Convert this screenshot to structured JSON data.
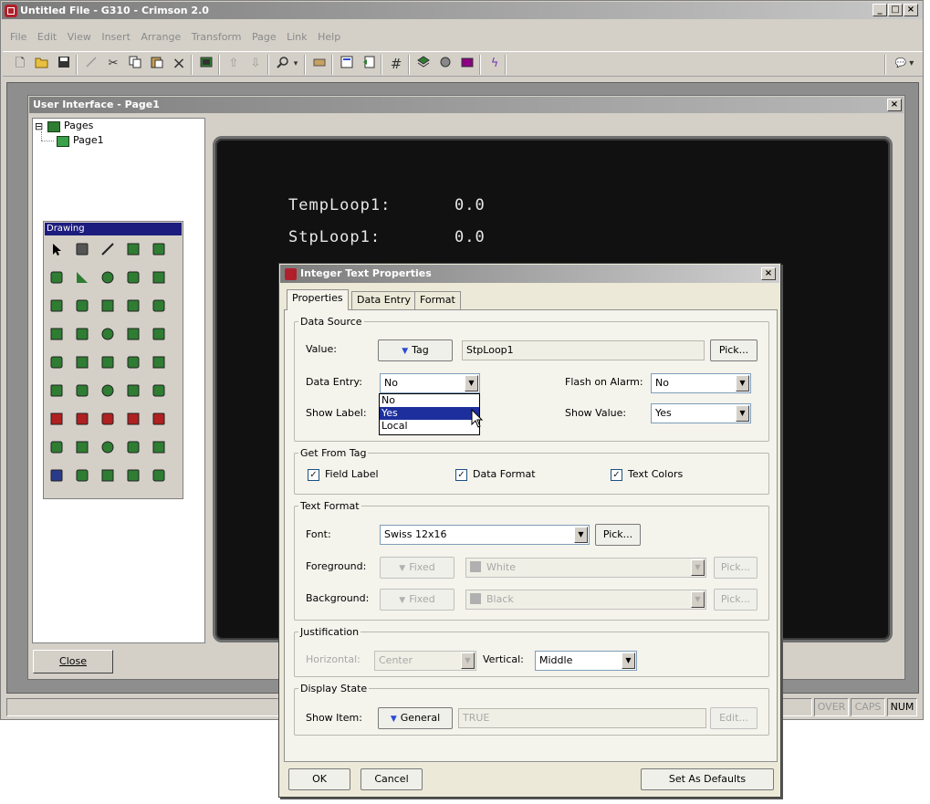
{
  "app": {
    "title": "Untitled File - G310 - Crimson 2.0",
    "min": "_",
    "max": "□",
    "close": "×",
    "menu": [
      "File",
      "Edit",
      "View",
      "Insert",
      "Arrange",
      "Transform",
      "Page",
      "Link",
      "Help"
    ],
    "toolbar_icons": [
      "new-icon",
      "open-icon",
      "save-icon",
      "line-icon",
      "cut-icon",
      "copy-icon",
      "paste-icon",
      "delete-icon",
      "widget-icon",
      "up-icon",
      "down-icon",
      "zoom-icon",
      "display-icon",
      "properties-icon",
      "pages-icon",
      "grid-icon",
      "layers-icon",
      "color-icon",
      "lightning-icon"
    ],
    "zoom_arrow": "▾",
    "comment_glyph": "💬 ▾"
  },
  "child_window": {
    "title": "User Interface - Page1",
    "close": "×",
    "tree": {
      "root": "Pages",
      "expander": "⊟",
      "page": "Page1"
    },
    "close_button": "Close"
  },
  "drawing_palette": {
    "title": "Drawing",
    "tool_count": 45
  },
  "screen": {
    "rows": [
      {
        "label": "TempLoop1:",
        "value": "0.0"
      },
      {
        "label": "StpLoop1:",
        "value": "0.0"
      }
    ]
  },
  "status_bar": {
    "over": "OVER",
    "caps": "CAPS",
    "num": "NUM"
  },
  "dialog": {
    "title": "Integer Text Properties",
    "close": "×",
    "tabs": [
      "Properties",
      "Data Entry",
      "Format"
    ],
    "data_source": {
      "legend": "Data Source",
      "value_label": "Value:",
      "value_mode": "Tag",
      "value": "StpLoop1",
      "value_pick": "Pick...",
      "data_entry_label": "Data Entry:",
      "data_entry": "No",
      "data_entry_options": [
        "No",
        "Yes",
        "Local"
      ],
      "data_entry_highlight": "Yes",
      "show_label_label": "Show Label:",
      "flash_label": "Flash on Alarm:",
      "flash": "No",
      "show_value_label": "Show Value:",
      "show_value": "Yes"
    },
    "get_from_tag": {
      "legend": "Get From Tag",
      "field_label": "Field Label",
      "data_format": "Data Format",
      "text_colors": "Text Colors",
      "check": "✓"
    },
    "text_format": {
      "legend": "Text Format",
      "font_label": "Font:",
      "font": "Swiss 12x16",
      "font_pick": "Pick...",
      "foreground_label": "Foreground:",
      "foreground_mode": "Fixed",
      "foreground": "White",
      "foreground_pick": "Pick...",
      "background_label": "Background:",
      "background_mode": "Fixed",
      "background": "Black",
      "background_pick": "Pick..."
    },
    "justification": {
      "legend": "Justification",
      "horizontal_label": "Horizontal:",
      "horizontal": "Center",
      "vertical_label": "Vertical:",
      "vertical": "Middle"
    },
    "display_state": {
      "legend": "Display State",
      "show_item_label": "Show Item:",
      "show_item_mode": "General",
      "show_item": "TRUE",
      "edit": "Edit..."
    },
    "buttons": {
      "ok": "OK",
      "cancel": "Cancel",
      "defaults": "Set As Defaults"
    }
  },
  "colors": {
    "lcd_bg": "#111111",
    "lcd_text": "#e8e8e8",
    "selection": "#1c2f9c",
    "palette_title": "#1c1c7e"
  }
}
